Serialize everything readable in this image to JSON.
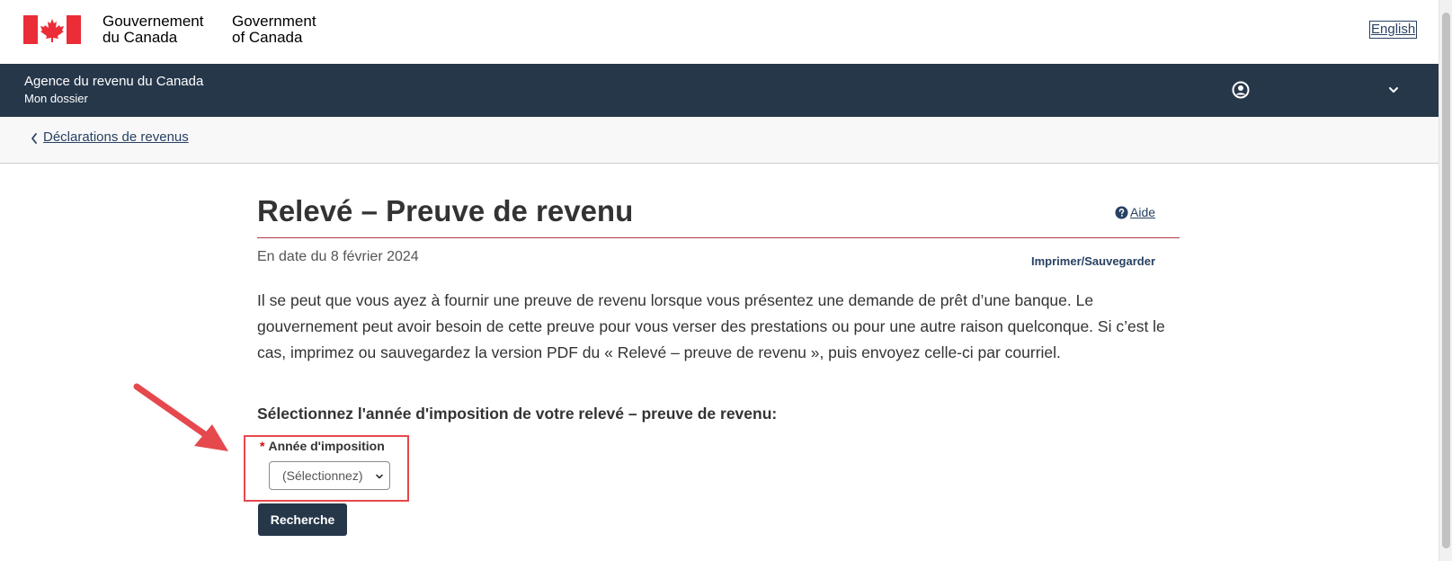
{
  "gov_header": {
    "fr_line1": "Gouvernement",
    "fr_line2": "du Canada",
    "en_line1": "Government",
    "en_line2": "of Canada",
    "language_toggle": "English"
  },
  "app_bar": {
    "agency": "Agence du revenu du Canada",
    "section": "Mon dossier",
    "account_icon": "account-circle-icon",
    "menu_icon": "chevron-down-icon"
  },
  "breadcrumb": {
    "back_label": "Déclarations de revenus"
  },
  "page": {
    "title": "Relevé – Preuve de revenu",
    "help_label": "Aide",
    "date_line": "En date du 8 février 2024",
    "print_label": "Imprimer/Sauvegarder",
    "intro": "Il se peut que vous ayez à fournir une preuve de revenu lorsque vous présentez une demande de prêt d’une banque. Le gouvernement peut avoir besoin de cette preuve pour vous verser des prestations ou pour une autre raison quelconque. Si c’est le cas, imprimez ou sauvegardez la version PDF du « Relevé – preuve de revenu », puis envoyez celle-ci par courriel.",
    "select_heading": "Sélectionnez l'année d'imposition de votre relevé – preuve de revenu:"
  },
  "form": {
    "required_marker": "*",
    "year_label": "Année d'imposition",
    "year_selected": "(Sélectionnez)",
    "search_button": "Recherche"
  },
  "colors": {
    "header_bg": "#26374a",
    "flag_red": "#eb2d37",
    "link": "#284162",
    "title_rule": "#af3c43",
    "annotation": "#e5484d"
  }
}
